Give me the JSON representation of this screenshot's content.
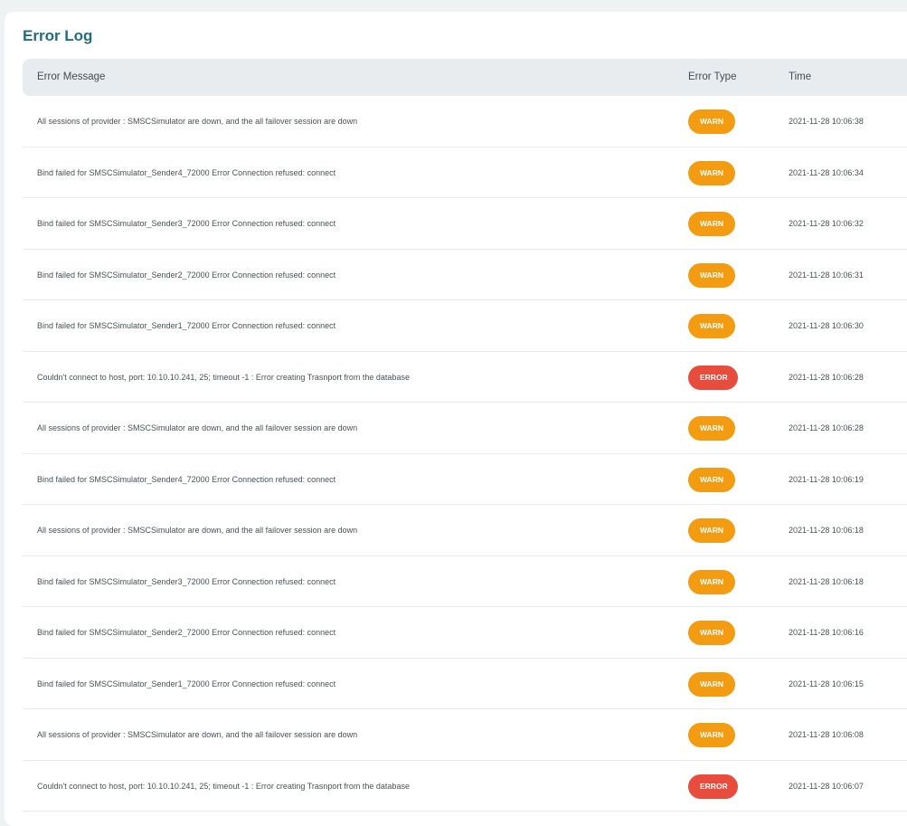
{
  "page": {
    "title": "Error Log"
  },
  "colors": {
    "title": "#1f6e7e",
    "warn": "#f39c12",
    "error": "#e74c3c",
    "header_bg": "#e8ecee"
  },
  "table": {
    "headers": {
      "message": "Error Message",
      "type": "Error Type",
      "time": "Time"
    },
    "rows": [
      {
        "message": "All sessions of provider : SMSCSimulator are down, and the all failover session are down",
        "type": "WARN",
        "time": "2021-11-28 10:06:38"
      },
      {
        "message": "Bind failed for SMSCSimulator_Sender4_72000 Error Connection refused: connect",
        "type": "WARN",
        "time": "2021-11-28 10:06:34"
      },
      {
        "message": "Bind failed for SMSCSimulator_Sender3_72000 Error Connection refused: connect",
        "type": "WARN",
        "time": "2021-11-28 10:06:32"
      },
      {
        "message": "Bind failed for SMSCSimulator_Sender2_72000 Error Connection refused: connect",
        "type": "WARN",
        "time": "2021-11-28 10:06:31"
      },
      {
        "message": "Bind failed for SMSCSimulator_Sender1_72000 Error Connection refused: connect",
        "type": "WARN",
        "time": "2021-11-28 10:06:30"
      },
      {
        "message": "Couldn't connect to host, port: 10.10.10.241, 25; timeout -1 : Error creating Trasnport from the database",
        "type": "ERROR",
        "time": "2021-11-28 10:06:28"
      },
      {
        "message": "All sessions of provider : SMSCSimulator are down, and the all failover session are down",
        "type": "WARN",
        "time": "2021-11-28 10:06:28"
      },
      {
        "message": "Bind failed for SMSCSimulator_Sender4_72000 Error Connection refused: connect",
        "type": "WARN",
        "time": "2021-11-28 10:06:19"
      },
      {
        "message": "All sessions of provider : SMSCSimulator are down, and the all failover session are down",
        "type": "WARN",
        "time": "2021-11-28 10:06:18"
      },
      {
        "message": "Bind failed for SMSCSimulator_Sender3_72000 Error Connection refused: connect",
        "type": "WARN",
        "time": "2021-11-28 10:06:18"
      },
      {
        "message": "Bind failed for SMSCSimulator_Sender2_72000 Error Connection refused: connect",
        "type": "WARN",
        "time": "2021-11-28 10:06:16"
      },
      {
        "message": "Bind failed for SMSCSimulator_Sender1_72000 Error Connection refused: connect",
        "type": "WARN",
        "time": "2021-11-28 10:06:15"
      },
      {
        "message": "All sessions of provider : SMSCSimulator are down, and the all failover session are down",
        "type": "WARN",
        "time": "2021-11-28 10:06:08"
      },
      {
        "message": "Couldn't connect to host, port: 10.10.10.241, 25; timeout -1 : Error creating Trasnport from the database",
        "type": "ERROR",
        "time": "2021-11-28 10:06:07"
      }
    ]
  }
}
